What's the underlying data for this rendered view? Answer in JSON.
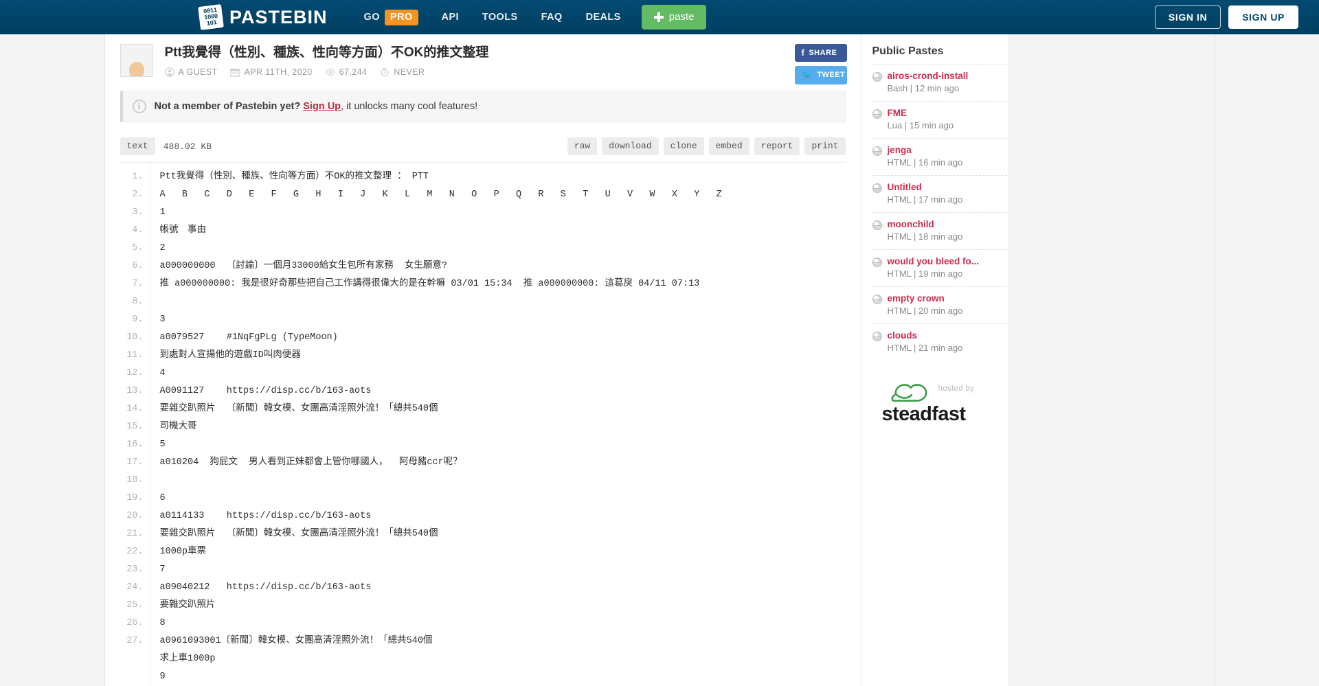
{
  "topnav": {
    "brand": "PASTEBIN",
    "brand_mark_lines": [
      "0011",
      "1000",
      "101"
    ],
    "go_label": "GO",
    "pro_label": "PRO",
    "links": [
      "API",
      "TOOLS",
      "FAQ",
      "DEALS"
    ],
    "paste_button": "paste",
    "sign_in": "SIGN IN",
    "sign_up": "SIGN UP",
    "colors": {
      "bar": "#02486d",
      "pro": "#f79421",
      "paste": "#63bb63"
    }
  },
  "paste": {
    "title": "Ptt我覺得（性別、種族、性向等方面）不OK的推文整理",
    "author": "A GUEST",
    "date": "APR 11TH, 2020",
    "views": "67,244",
    "expires": "NEVER",
    "share_label": "SHARE",
    "tweet_label": "TWEET"
  },
  "notice": {
    "text_before": "Not a member of Pastebin yet?",
    "link": "Sign Up",
    "text_after": ", it unlocks many cool features!"
  },
  "toolbar": {
    "format": "text",
    "size": "488.02 KB",
    "actions": [
      "raw",
      "download",
      "clone",
      "embed",
      "report",
      "print"
    ]
  },
  "code": {
    "lines": [
      {
        "n": "1.",
        "text": "Ptt我覺得（性別、種族、性向等方面）不OK的推文整理 ： PTT"
      },
      {
        "n": "2.",
        "text": "A   B   C   D   E   F   G   H   I   J   K   L   M   N   O   P   Q   R   S   T   U   V   W   X   Y   Z"
      },
      {
        "n": "3.",
        "text": "1"
      },
      {
        "n": "4.",
        "text": "帳號　事由"
      },
      {
        "n": "5.",
        "text": "2"
      },
      {
        "n": "6.",
        "text": "a000000000  〔討論〕一個月33000給女生包所有家務  女生願意?"
      },
      {
        "n": "7.",
        "text": "推 a000000000: 我是很好奇那些把自己工作講得很偉大的是在幹嘛 03/01 15:34  推 a000000000: 這葛戾 04/11 07:13"
      },
      {
        "n": "",
        "text": ""
      },
      {
        "n": "8.",
        "text": "3"
      },
      {
        "n": "9.",
        "text": "a0079527    #1NqFgPLg (TypeMoon)"
      },
      {
        "n": "10.",
        "text": "到處對人宣揚他的遊戲ID叫肉便器"
      },
      {
        "n": "11.",
        "text": "4"
      },
      {
        "n": "12.",
        "text": "A0091127    https://disp.cc/b/163-aots"
      },
      {
        "n": "13.",
        "text": "要雜交趴照片  〔新聞〕韓女模、女團高清淫照外流！「總共540個"
      },
      {
        "n": "14.",
        "text": "司機大哥"
      },
      {
        "n": "15.",
        "text": "5"
      },
      {
        "n": "16.",
        "text": "a010204  狗屁文  男人看到正妹都會上管你哪國人，  阿母豬ccr呢？"
      },
      {
        "n": "",
        "text": ""
      },
      {
        "n": "17.",
        "text": "6"
      },
      {
        "n": "18.",
        "text": "a0114133    https://disp.cc/b/163-aots"
      },
      {
        "n": "19.",
        "text": "要雜交趴照片  〔新聞〕韓女模、女團高清淫照外流！「總共540個"
      },
      {
        "n": "20.",
        "text": "1000p車票"
      },
      {
        "n": "21.",
        "text": "7"
      },
      {
        "n": "22.",
        "text": "a09040212   https://disp.cc/b/163-aots"
      },
      {
        "n": "23.",
        "text": "要雜交趴照片"
      },
      {
        "n": "24.",
        "text": "8"
      },
      {
        "n": "25.",
        "text": "a0961093001〔新聞〕韓女模、女團高清淫照外流！「總共540個"
      },
      {
        "n": "26.",
        "text": "求上車1000p"
      },
      {
        "n": "27.",
        "text": "9"
      }
    ]
  },
  "sidebar": {
    "title": "Public Pastes",
    "items": [
      {
        "name": "airos-crond-install",
        "meta": "Bash | 12 min ago"
      },
      {
        "name": "FME",
        "meta": "Lua | 15 min ago"
      },
      {
        "name": "jenga",
        "meta": "HTML | 16 min ago"
      },
      {
        "name": "Untitled",
        "meta": "HTML | 17 min ago"
      },
      {
        "name": "moonchild",
        "meta": "HTML | 18 min ago"
      },
      {
        "name": "would you bleed fo...",
        "meta": "HTML | 19 min ago"
      },
      {
        "name": "empty crown",
        "meta": "HTML | 20 min ago"
      },
      {
        "name": "clouds",
        "meta": "HTML | 21 min ago"
      }
    ],
    "host": {
      "hosted_by": "hosted by",
      "name": "steadfast"
    }
  }
}
